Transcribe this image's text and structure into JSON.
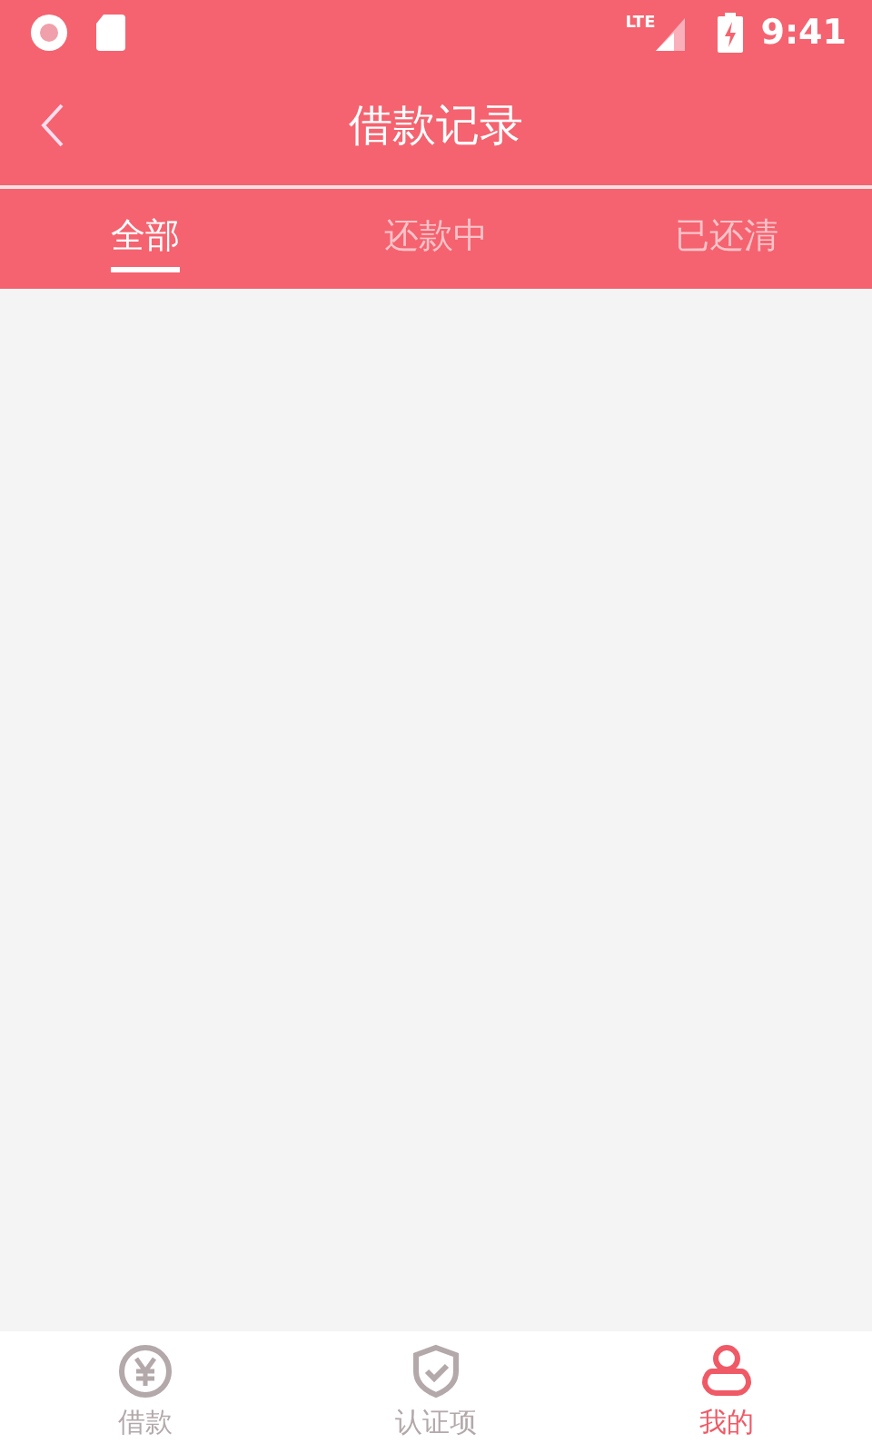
{
  "status_bar": {
    "network": "LTE",
    "time": "9:41"
  },
  "header": {
    "title": "借款记录"
  },
  "tabs": [
    {
      "label": "全部",
      "selected": true
    },
    {
      "label": "还款中",
      "selected": false
    },
    {
      "label": "已还清",
      "selected": false
    }
  ],
  "bottom_nav": [
    {
      "kind": "loan",
      "label": "借款",
      "selected": false
    },
    {
      "kind": "verify",
      "label": "认证项",
      "selected": false
    },
    {
      "kind": "profile",
      "label": "我的",
      "selected": true
    }
  ]
}
